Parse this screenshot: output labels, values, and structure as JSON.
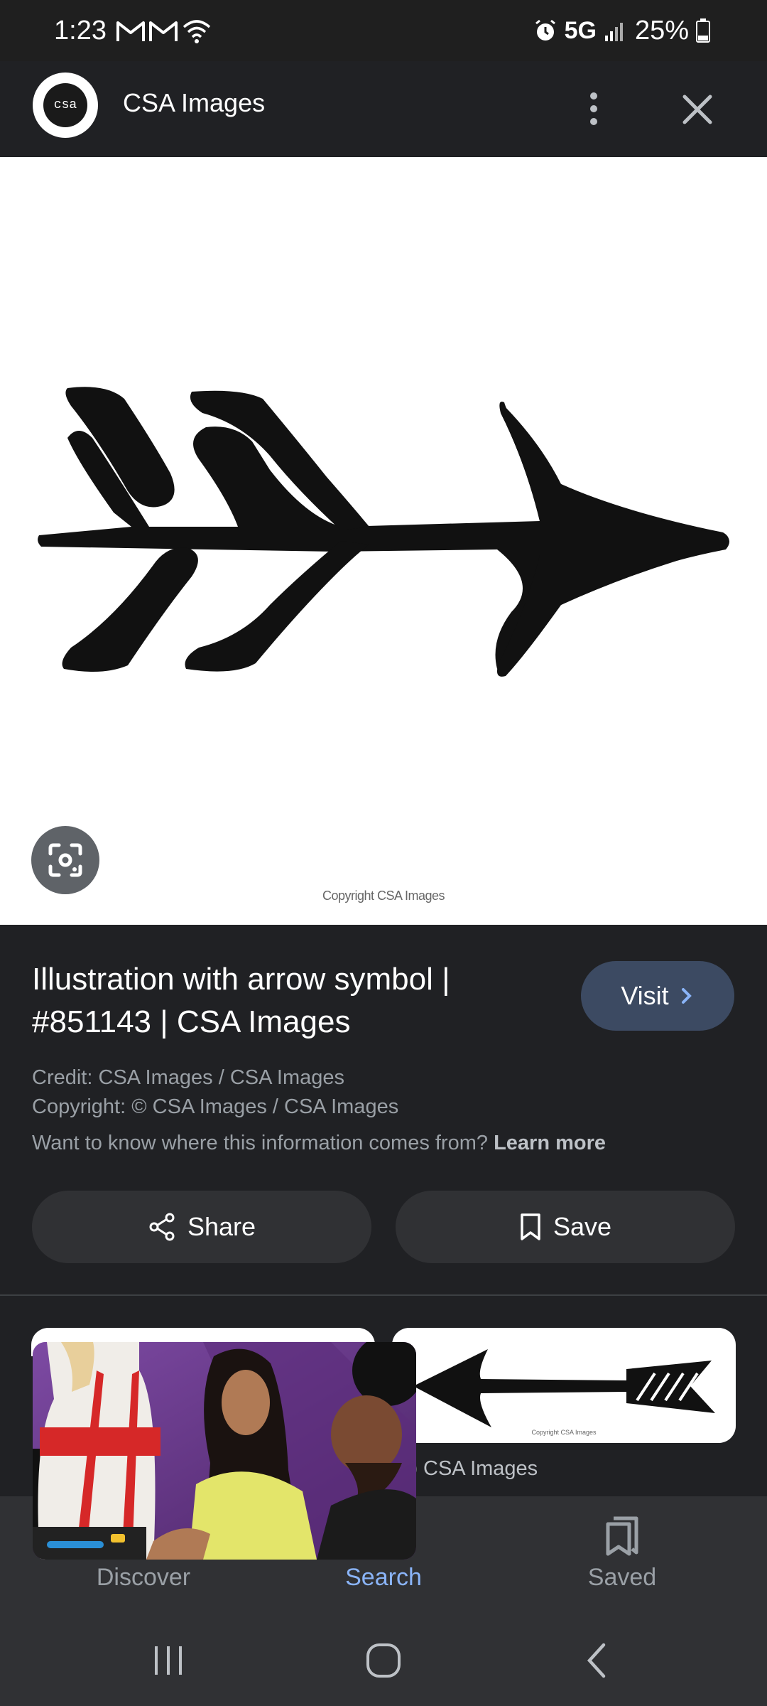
{
  "status_bar": {
    "time": "1:23",
    "network": "5G",
    "battery": "25%"
  },
  "header": {
    "site_name": "CSA Images",
    "logo_text": "csa"
  },
  "image": {
    "copyright": "Copyright CSA Images"
  },
  "info": {
    "title": "Illustration with arrow symbol | #851143 | CSA Images",
    "visit_label": "Visit",
    "credit": "Credit: CSA Images / CSA Images",
    "copyright": "Copyright: © CSA Images / CSA Images",
    "info_question": "Want to know where this information comes from?",
    "learn_more": "Learn more"
  },
  "actions": {
    "share_label": "Share",
    "save_label": "Save"
  },
  "related": {
    "source_2": "CSA Images"
  },
  "bottom_nav": {
    "items": [
      {
        "label": "Discover",
        "icon": "discover-icon"
      },
      {
        "label": "Search",
        "icon": "search-icon",
        "active": true
      },
      {
        "label": "Saved",
        "icon": "saved-icon"
      }
    ]
  },
  "colors": {
    "accent": "#8ab4f8",
    "background": "#202124",
    "visit_button": "#3c4a62"
  }
}
